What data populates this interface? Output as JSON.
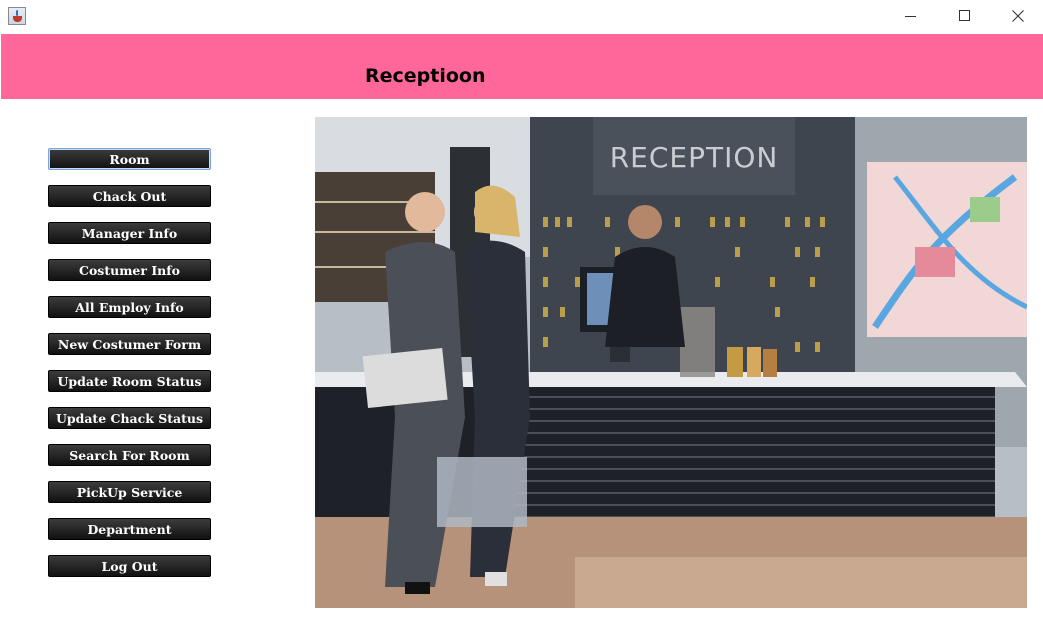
{
  "window": {
    "minimize_icon": "minimize-icon",
    "maximize_icon": "maximize-icon",
    "close_icon": "close-icon"
  },
  "header": {
    "title": "Receptioon",
    "background_color": "#ff6699"
  },
  "menu": {
    "buttons": [
      {
        "label": "Room"
      },
      {
        "label": "Chack Out"
      },
      {
        "label": "Manager Info"
      },
      {
        "label": "Costumer Info"
      },
      {
        "label": "All Employ Info"
      },
      {
        "label": "New Costumer Form"
      },
      {
        "label": "Update Room Status"
      },
      {
        "label": "Update Chack Status"
      },
      {
        "label": "Search For Room"
      },
      {
        "label": "PickUp Service"
      },
      {
        "label": "Department"
      },
      {
        "label": "Log Out"
      }
    ]
  },
  "photo": {
    "sign_text": "RECEPTION"
  }
}
